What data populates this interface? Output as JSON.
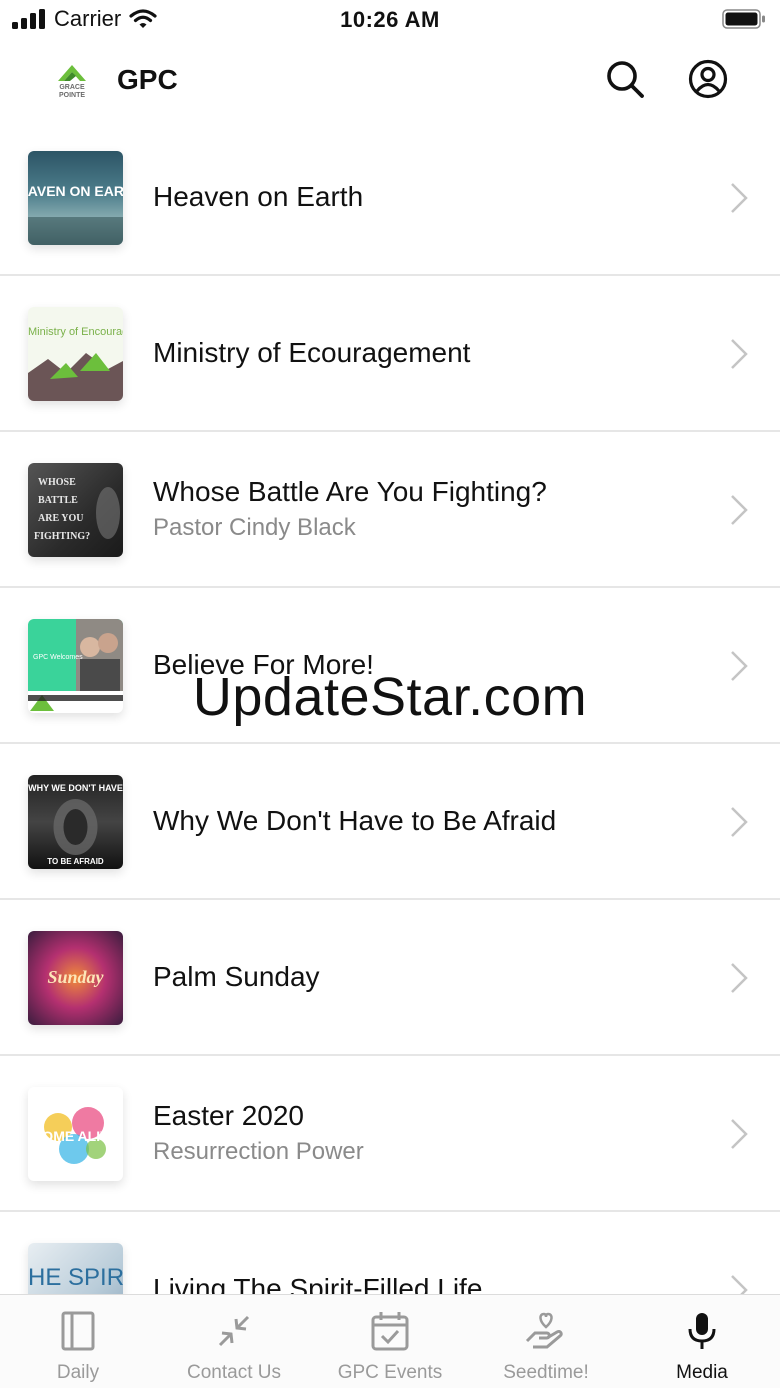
{
  "status_bar": {
    "carrier": "Carrier",
    "time": "10:26 AM"
  },
  "header": {
    "title": "GPC",
    "logo_text": "GRACE POINTE"
  },
  "items": [
    {
      "title": "Heaven on Earth",
      "subtitle": "",
      "art_text": "HEAVEN ON EARTH"
    },
    {
      "title": "Ministry of Ecouragement",
      "subtitle": "",
      "art_text": "Ministry of Encouragement"
    },
    {
      "title": "Whose Battle Are You Fighting?",
      "subtitle": "Pastor Cindy Black",
      "art_text": "WHOSE BATTLE ARE YOU FIGHTING?"
    },
    {
      "title": "Believe For More!",
      "subtitle": "",
      "art_text": "GPC Welcomes"
    },
    {
      "title": "Why We Don't Have to Be Afraid",
      "subtitle": "",
      "art_text": "WHY WE DON'T HAVE"
    },
    {
      "title": "Palm Sunday",
      "subtitle": "",
      "art_text": "Sunday"
    },
    {
      "title": "Easter 2020",
      "subtitle": "Resurrection Power",
      "art_text": "COME ALIVE"
    },
    {
      "title": "Living The Spirit-Filled Life",
      "subtitle": "",
      "art_text": "HE SPIRI"
    }
  ],
  "watermark": "UpdateStar.com",
  "tabs": [
    {
      "label": "Daily",
      "icon": "book-icon",
      "active": false
    },
    {
      "label": "Contact Us",
      "icon": "arrows-in-icon",
      "active": false
    },
    {
      "label": "GPC Events",
      "icon": "calendar-check-icon",
      "active": false
    },
    {
      "label": "Seedtime!",
      "icon": "hand-heart-icon",
      "active": false
    },
    {
      "label": "Media",
      "icon": "microphone-icon",
      "active": true
    }
  ],
  "colors": {
    "accent": "#111111",
    "inactive": "#9a9a9a",
    "logo_green": "#6cbf3c"
  }
}
